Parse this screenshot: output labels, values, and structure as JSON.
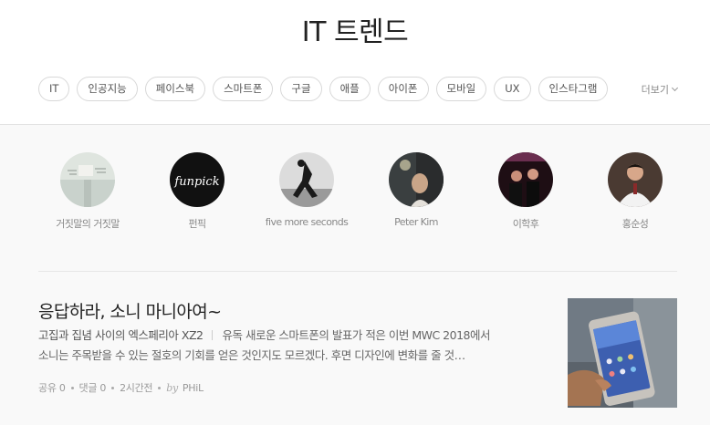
{
  "header": {
    "title": "IT 트렌드",
    "tags": [
      "IT",
      "인공지능",
      "페이스북",
      "스마트폰",
      "구글",
      "애플",
      "아이폰",
      "모바일",
      "UX",
      "인스타그램"
    ],
    "more_label": "더보기"
  },
  "creators": [
    {
      "name": "거짓말의 거짓말"
    },
    {
      "name": "펀픽",
      "avatar_text": "funpick"
    },
    {
      "name": "five more seconds"
    },
    {
      "name": "Peter Kim"
    },
    {
      "name": "이학후"
    },
    {
      "name": "홍순성"
    }
  ],
  "article": {
    "title": "응답하라, 소니 마니아여~",
    "subtitle": "고집과 집념 사이의 엑스페리아 XZ2",
    "excerpt_line1": "유독 새로운 스마트폰의 발표가 적은 이번 MWC 2018에서",
    "excerpt_line2": "소니는 주목받을 수 있는 절호의 기회를 얻은 것인지도 모르겠다. 후면 디자인에 변화를 줄 것…",
    "shares": "공유 0",
    "comments": "댓글 0",
    "time": "2시간전",
    "by_label": "by",
    "author": "PHiL"
  },
  "colors": {
    "background": "#f9f9f9",
    "header_background": "#ffffff",
    "border": "#e3e3e3",
    "text_primary": "#222222",
    "text_muted": "#999999"
  }
}
